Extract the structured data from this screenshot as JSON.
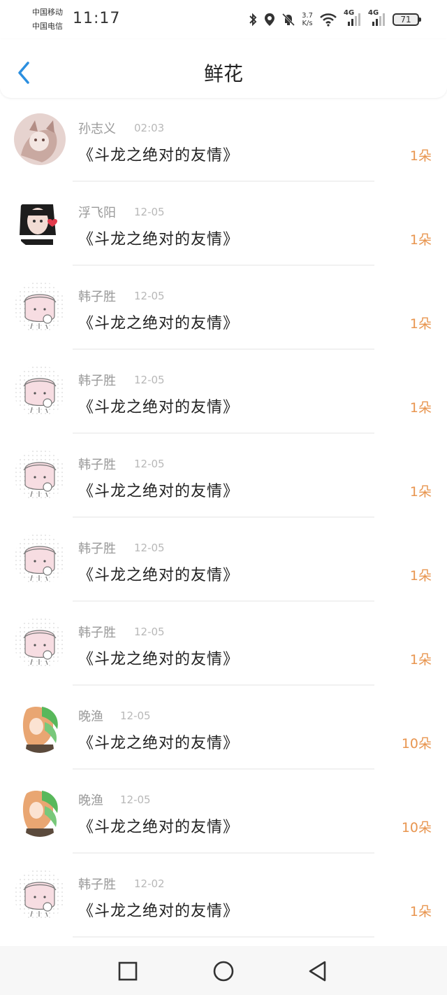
{
  "status_bar": {
    "carrier1": "中国移动",
    "carrier2": "中国电信",
    "time": "11:17",
    "speed_value": "3.7",
    "speed_unit": "K/s",
    "net1": "4G",
    "net2": "4G",
    "battery": "71",
    "icons": [
      "bluetooth-icon",
      "location-icon",
      "mute-bell-icon",
      "wifi-icon",
      "signal-icon",
      "signal-icon",
      "battery-icon"
    ]
  },
  "header": {
    "title": "鲜花",
    "back_icon": "chevron-left-icon"
  },
  "colors": {
    "accent_back": "#2b8fe0",
    "count": "#e8954f",
    "name": "#9a9a9a",
    "date": "#b8b8b8"
  },
  "items": [
    {
      "name": "孙志义",
      "date": "02:03",
      "work": "《斗龙之绝对的友情》",
      "count": "1朵",
      "avatar": "avatar-cat"
    },
    {
      "name": "浮飞阳",
      "date": "12-05",
      "work": "《斗龙之绝对的友情》",
      "count": "1朵",
      "avatar": "avatar-girl"
    },
    {
      "name": "韩子胜",
      "date": "12-05",
      "work": "《斗龙之绝对的友情》",
      "count": "1朵",
      "avatar": "avatar-cartoon"
    },
    {
      "name": "韩子胜",
      "date": "12-05",
      "work": "《斗龙之绝对的友情》",
      "count": "1朵",
      "avatar": "avatar-cartoon"
    },
    {
      "name": "韩子胜",
      "date": "12-05",
      "work": "《斗龙之绝对的友情》",
      "count": "1朵",
      "avatar": "avatar-cartoon"
    },
    {
      "name": "韩子胜",
      "date": "12-05",
      "work": "《斗龙之绝对的友情》",
      "count": "1朵",
      "avatar": "avatar-cartoon"
    },
    {
      "name": "韩子胜",
      "date": "12-05",
      "work": "《斗龙之绝对的友情》",
      "count": "1朵",
      "avatar": "avatar-cartoon"
    },
    {
      "name": "晚渔",
      "date": "12-05",
      "work": "《斗龙之绝对的友情》",
      "count": "10朵",
      "avatar": "avatar-anime"
    },
    {
      "name": "晚渔",
      "date": "12-05",
      "work": "《斗龙之绝对的友情》",
      "count": "10朵",
      "avatar": "avatar-anime"
    },
    {
      "name": "韩子胜",
      "date": "12-02",
      "work": "《斗龙之绝对的友情》",
      "count": "1朵",
      "avatar": "avatar-cartoon"
    }
  ],
  "nav_bar": {
    "buttons": [
      "recents-square-icon",
      "home-circle-icon",
      "back-triangle-icon"
    ]
  }
}
